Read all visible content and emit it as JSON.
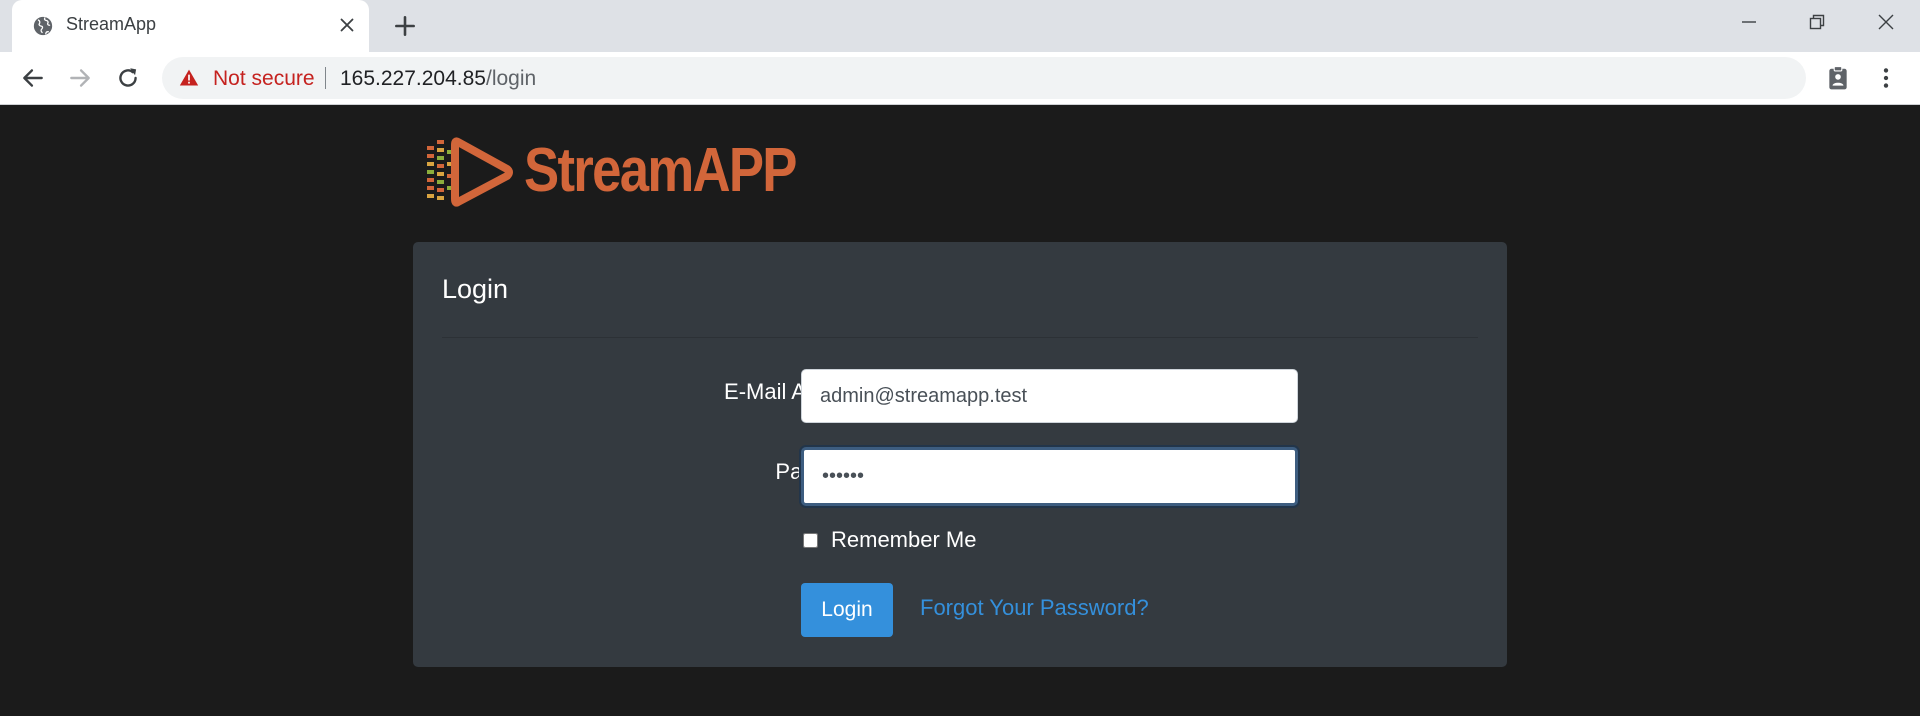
{
  "browser": {
    "tab_title": "StreamApp",
    "security_label": "Not secure",
    "url_host": "165.227.204.85",
    "url_path": "/login"
  },
  "logo": {
    "text": "StreamAPP",
    "color": "#d2663a"
  },
  "login": {
    "title": "Login",
    "email_label": "E-Mail Address",
    "email_value": "admin@streamapp.test",
    "password_label": "Password",
    "password_value": "••••••",
    "remember_label": "Remember Me",
    "remember_checked": false,
    "submit_label": "Login",
    "forgot_label": "Forgot Your Password?"
  },
  "colors": {
    "primary": "#3490dc",
    "card_bg": "#343a40",
    "page_bg": "#1b1b1b",
    "warning": "#c5221f"
  },
  "icons": {
    "favicon": "globe-icon",
    "tab_close": "close-icon",
    "new_tab": "plus-icon",
    "back": "back-arrow-icon",
    "forward": "forward-arrow-icon",
    "reload": "reload-icon",
    "security": "warning-triangle-icon",
    "profile": "clipboard-person-icon",
    "menu": "kebab-menu-icon"
  }
}
